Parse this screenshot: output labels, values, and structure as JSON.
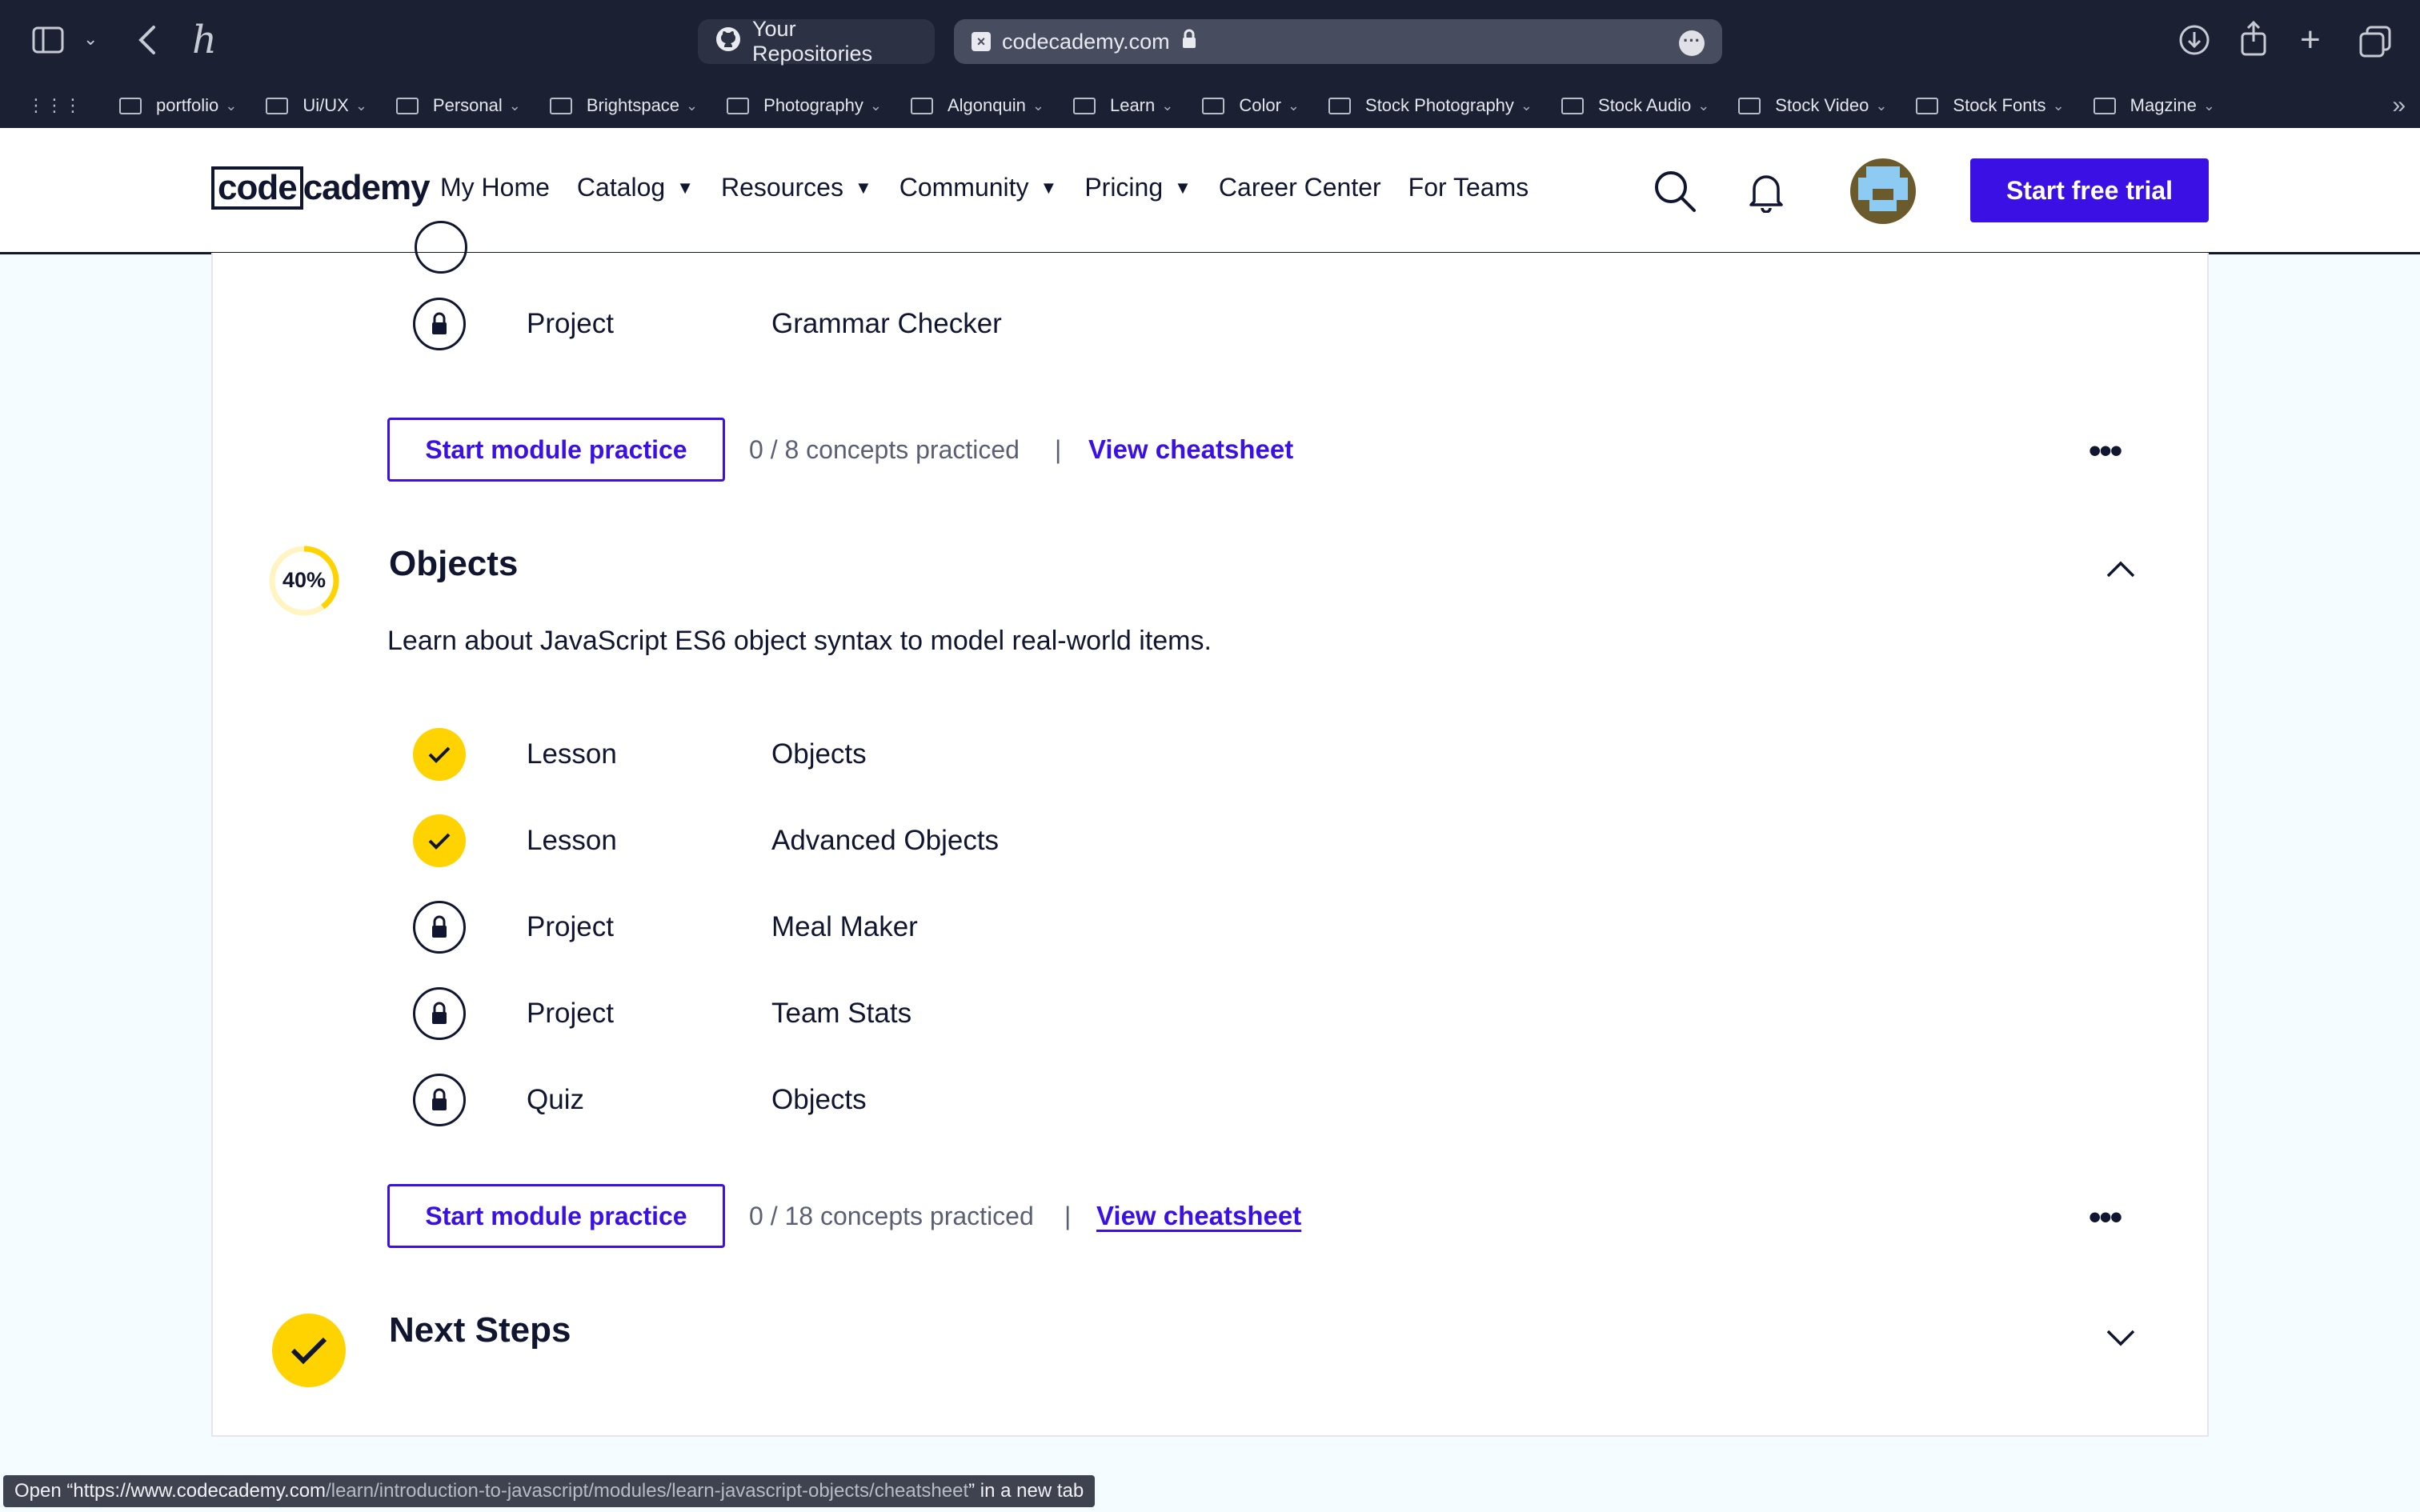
{
  "browser": {
    "tabs": [
      {
        "label": "Your Repositories",
        "icon": "github-icon"
      },
      {
        "label": "codecademy.com",
        "icon": "codecademy-favicon"
      }
    ],
    "bookmarks": [
      "portfolio",
      "Ui/UX",
      "Personal",
      "Brightspace",
      "Photography",
      "Algonquin",
      "Learn",
      "Color",
      "Stock Photography",
      "Stock Audio",
      "Stock Video",
      "Stock Fonts",
      "Magzine"
    ]
  },
  "header": {
    "logo_boxed": "code",
    "logo_rest": "cademy",
    "nav": [
      {
        "label": "My Home",
        "dropdown": false
      },
      {
        "label": "Catalog",
        "dropdown": true
      },
      {
        "label": "Resources",
        "dropdown": true
      },
      {
        "label": "Community",
        "dropdown": true
      },
      {
        "label": "Pricing",
        "dropdown": true
      },
      {
        "label": "Career Center",
        "dropdown": false
      },
      {
        "label": "For Teams",
        "dropdown": false
      }
    ],
    "cta": "Start free trial"
  },
  "prev_module": {
    "items": [
      {
        "type": "Project",
        "title": "Grammar Checker",
        "status": "locked"
      }
    ],
    "practice_button": "Start module practice",
    "concepts": "0 / 8 concepts practiced",
    "separator": "|",
    "cheatsheet": "View cheatsheet"
  },
  "objects_module": {
    "progress_label": "40%",
    "progress": 0.4,
    "title": "Objects",
    "description": "Learn about JavaScript ES6 object syntax to model real-world items.",
    "items": [
      {
        "type": "Lesson",
        "title": "Objects",
        "status": "complete"
      },
      {
        "type": "Lesson",
        "title": "Advanced Objects",
        "status": "complete"
      },
      {
        "type": "Project",
        "title": "Meal Maker",
        "status": "locked"
      },
      {
        "type": "Project",
        "title": "Team Stats",
        "status": "locked"
      },
      {
        "type": "Quiz",
        "title": "Objects",
        "status": "locked"
      }
    ],
    "practice_button": "Start module practice",
    "concepts": "0 / 18 concepts practiced",
    "separator": "|",
    "cheatsheet": "View cheatsheet"
  },
  "next_module": {
    "title": "Next Steps"
  },
  "status_bar": {
    "prefix": "Open “https://www.codecademy.com",
    "path": "/learn/introduction-to-javascript/modules/learn-javascript-objects/cheatsheet",
    "suffix": "” in a new tab"
  },
  "colors": {
    "brand": "#3a10e5",
    "complete": "#ffd300",
    "navy": "#10162f"
  }
}
